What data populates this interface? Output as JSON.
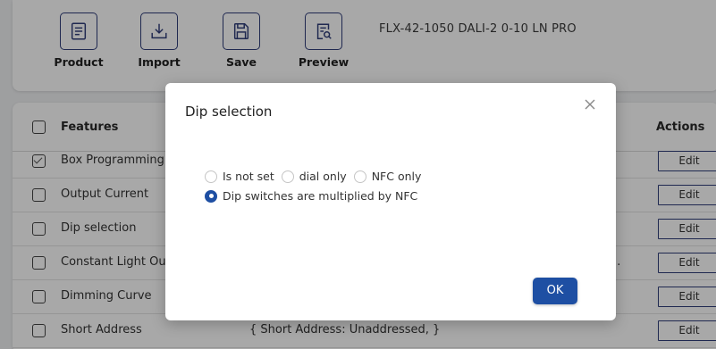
{
  "toolbar": {
    "product_label": "Product",
    "import_label": "Import",
    "save_label": "Save",
    "preview_label": "Preview",
    "product_name": "FLX-42-1050 DALI-2 0-10 LN PRO"
  },
  "table": {
    "header_features": "Features",
    "header_actions": "Actions",
    "edit_label": "Edit",
    "rows": [
      {
        "feature": "Box Programming",
        "value": "",
        "checked": true
      },
      {
        "feature": "Output Current",
        "value": "",
        "checked": false
      },
      {
        "feature": "Dip selection",
        "value": "",
        "checked": false
      },
      {
        "feature": "Constant Light Output",
        "value": "...",
        "checked": false
      },
      {
        "feature": "Dimming Curve",
        "value": "",
        "checked": false
      },
      {
        "feature": "Short Address",
        "value": "{ Short Address: Unaddressed, }",
        "checked": false
      }
    ]
  },
  "modal": {
    "title": "Dip selection",
    "options": [
      {
        "label": "Is not set",
        "selected": false
      },
      {
        "label": "dial only",
        "selected": false
      },
      {
        "label": "NFC only",
        "selected": false
      },
      {
        "label": "Dip switches are multiplied by NFC",
        "selected": true
      }
    ],
    "ok_label": "OK"
  },
  "colors": {
    "accent": "#1e4fa3",
    "toolbar_icon": "#2f3d7a",
    "overlay": "rgba(0,0,0,0.34)"
  },
  "icons": {
    "product": "document-lines-icon",
    "import": "download-tray-icon",
    "save": "floppy-disk-icon",
    "preview": "document-search-icon",
    "close": "close-icon"
  }
}
